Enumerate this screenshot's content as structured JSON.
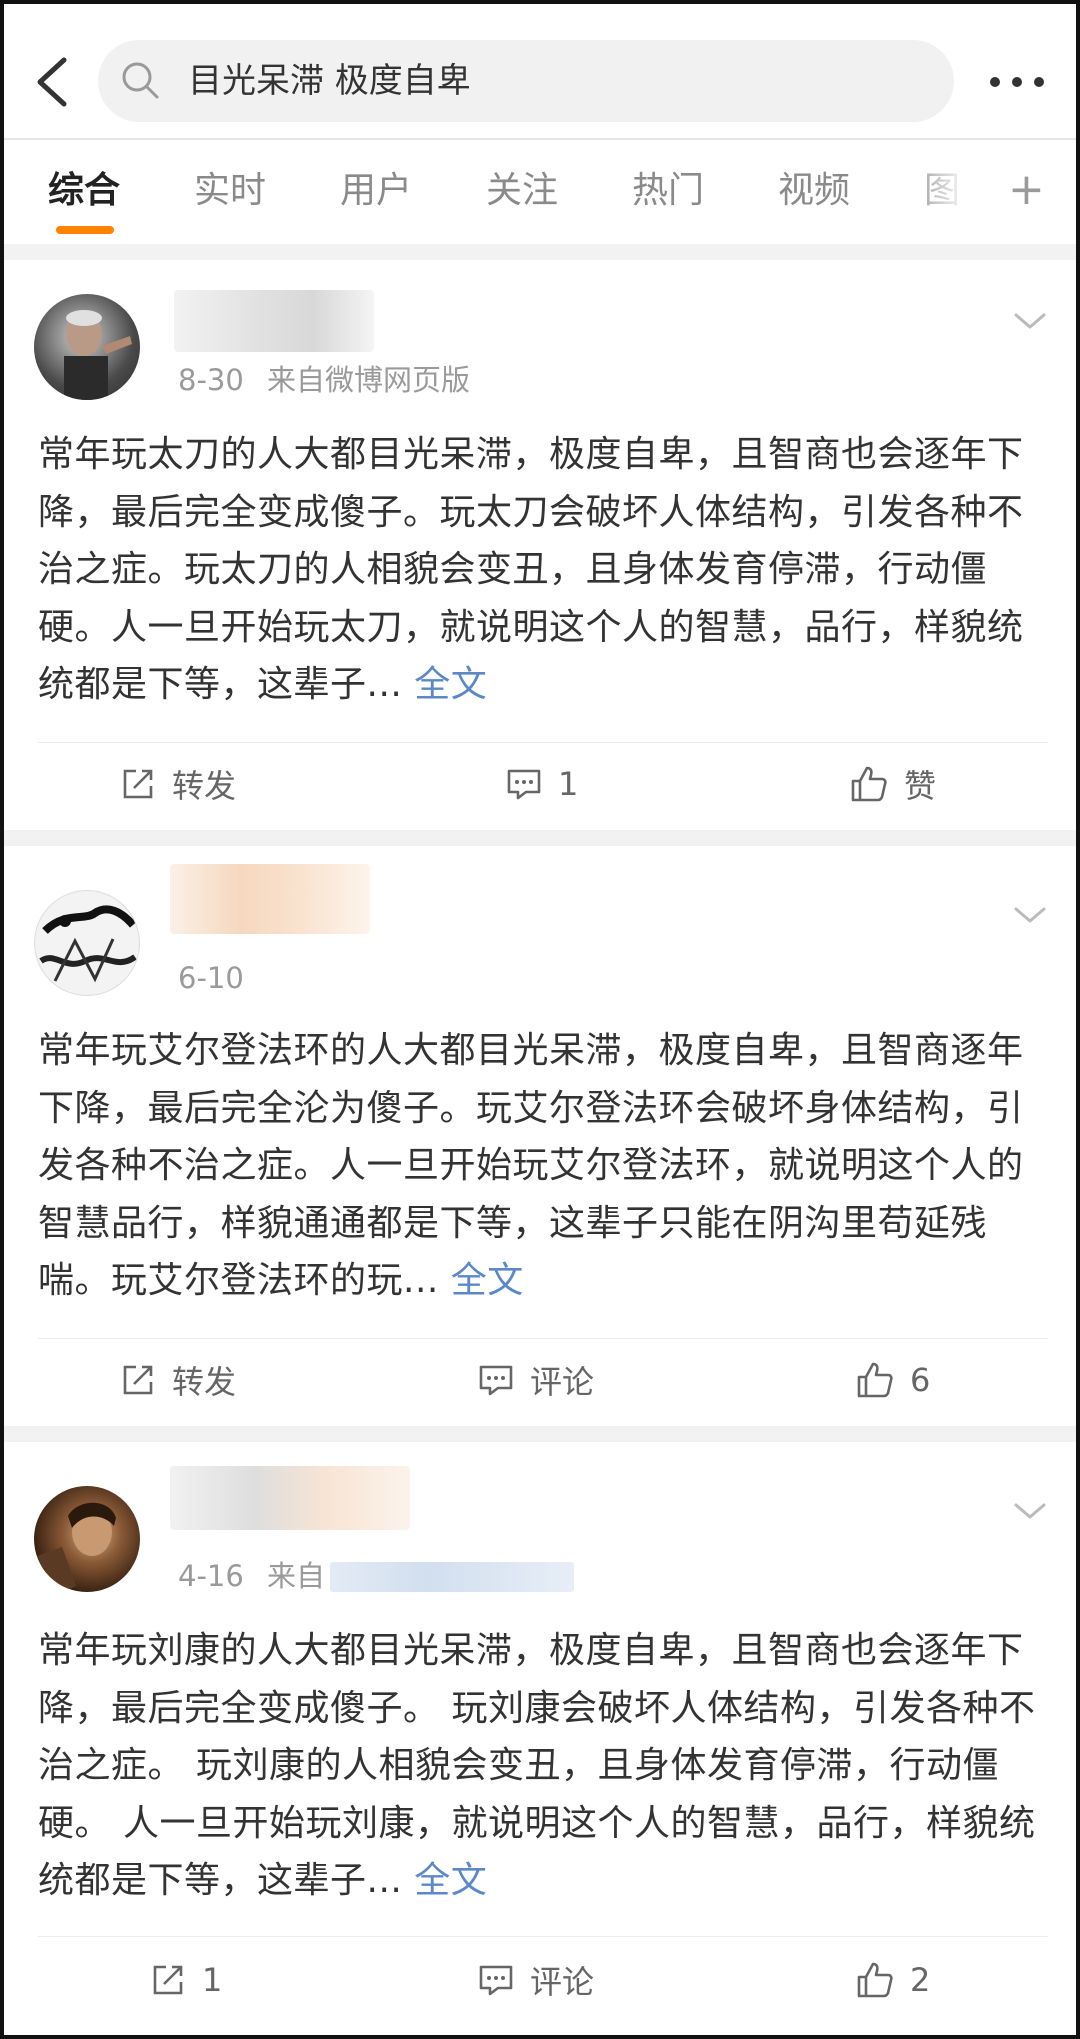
{
  "search": {
    "query": "目光呆滞 极度自卑"
  },
  "tabs": [
    {
      "label": "综合",
      "active": true
    },
    {
      "label": "实时"
    },
    {
      "label": "用户"
    },
    {
      "label": "关注"
    },
    {
      "label": "热门"
    },
    {
      "label": "视频"
    },
    {
      "label": "图"
    }
  ],
  "tab_plus": "+",
  "posts": [
    {
      "time": "8-30",
      "source": "来自微博网页版",
      "body": "常年玩太刀的人大都目光呆滞，极度自卑，且智商也会逐年下降，最后完全变成傻子。玩太刀会破坏人体结构，引发各种不治之症。玩太刀的人相貌会变丑，且身体发育停滞，行动僵硬。人一旦开始玩太刀，就说明这个人的智慧，品行，样貌统统都是下等，这辈子...",
      "more": "全文",
      "actions": {
        "repost": "转发",
        "comment": "1",
        "like": "赞"
      }
    },
    {
      "time": "6-10",
      "source": "",
      "body": "常年玩艾尔登法环的人大都目光呆滞，极度自卑，且智商逐年下降，最后完全沦为傻子。玩艾尔登法环会破坏身体结构，引发各种不治之症。人一旦开始玩艾尔登法环，就说明这个人的智慧品行，样貌通通都是下等，这辈子只能在阴沟里苟延残喘。玩艾尔登法环的玩...",
      "more": "全文",
      "actions": {
        "repost": "转发",
        "comment": "评论",
        "like": "6"
      }
    },
    {
      "time": "4-16",
      "source": "来自",
      "body": "常年玩刘康的人大都目光呆滞，极度自卑，且智商也会逐年下降，最后完全变成傻子。 玩刘康会破坏人体结构，引发各种不治之症。 玩刘康的人相貌会变丑，且身体发育停滞，行动僵硬。 人一旦开始玩刘康，就说明这个人的智慧，品行，样貌统统都是下等，这辈子...",
      "more": "全文",
      "actions": {
        "repost": "1",
        "comment": "评论",
        "like": "2"
      }
    }
  ],
  "colors": {
    "accent": "#ff8200",
    "link": "#5b88c9"
  },
  "icons": [
    "back-arrow-icon",
    "search-icon",
    "more-dots-icon",
    "chevron-down-icon",
    "repost-icon",
    "comment-icon",
    "like-icon",
    "plus-icon"
  ]
}
